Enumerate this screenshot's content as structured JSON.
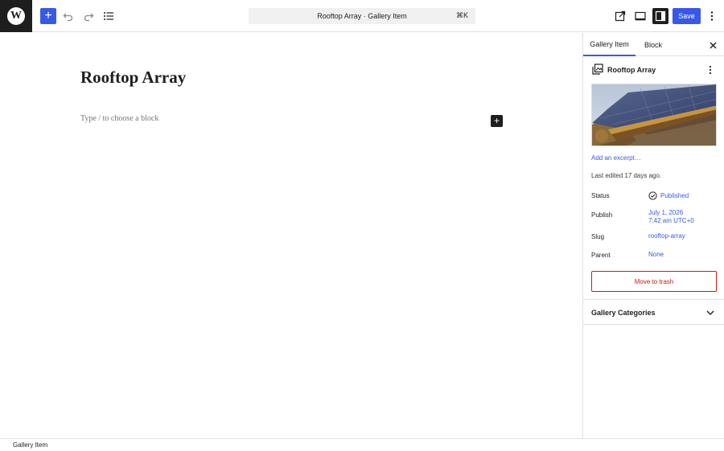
{
  "topbar": {
    "logo_icon": "wordpress-icon",
    "inserter_label": "+",
    "document_title": "Rooftop Array · Gallery Item",
    "command_shortcut": "⌘K",
    "save_label": "Save"
  },
  "editor": {
    "post_title": "Rooftop Array",
    "block_placeholder": "Type / to choose a block",
    "add_block_label": "+"
  },
  "sidebar": {
    "tabs": [
      {
        "label": "Gallery Item",
        "active": true
      },
      {
        "label": "Block",
        "active": false
      }
    ],
    "post_summary_title": "Rooftop Array",
    "excerpt_link": "Add an excerpt…",
    "last_edited": "Last edited 17 days ago.",
    "rows": {
      "status": {
        "label": "Status",
        "value": "Published"
      },
      "publish": {
        "label": "Publish",
        "value_line1": "July 1, 2026",
        "value_line2": "7:42 am UTC+0"
      },
      "slug": {
        "label": "Slug",
        "value": "rooftop-array"
      },
      "parent": {
        "label": "Parent",
        "value": "None"
      }
    },
    "trash_label": "Move to trash",
    "categories_panel_title": "Gallery Categories"
  },
  "footer": {
    "breadcrumb": "Gallery Item"
  },
  "colors": {
    "accent": "#3858e9",
    "danger": "#cc1818",
    "dark": "#1e1e1e"
  }
}
